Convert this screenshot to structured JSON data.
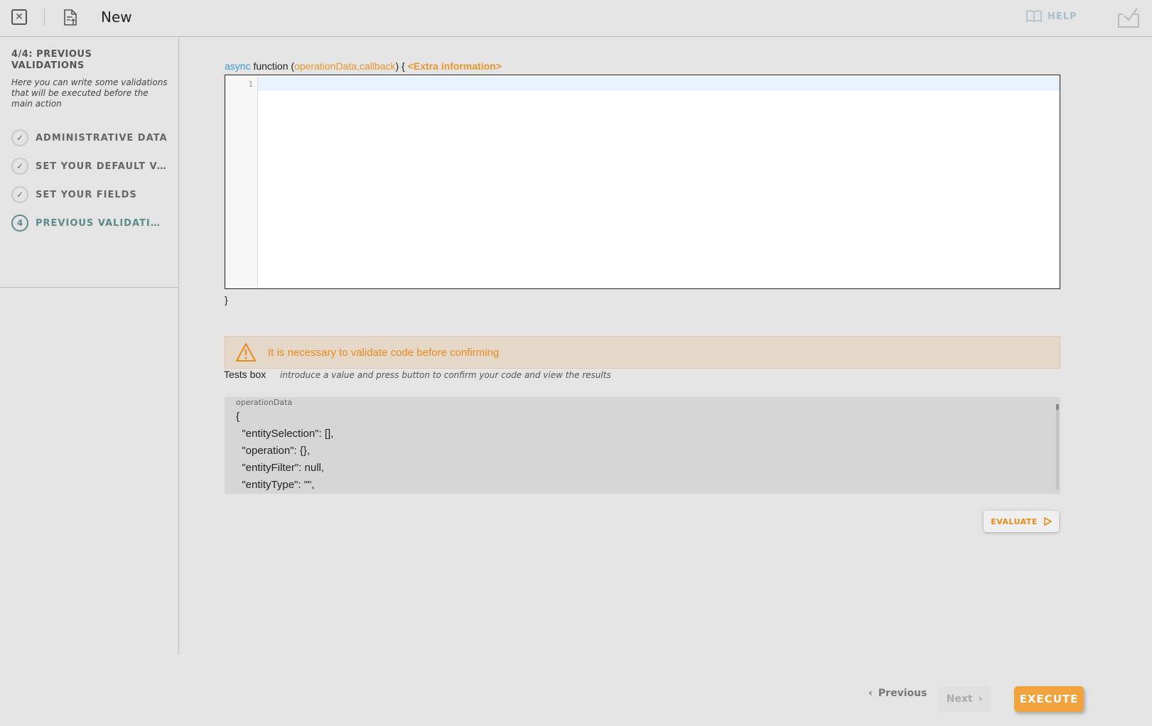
{
  "header": {
    "title": "New",
    "help_label": "HELP"
  },
  "sidebar": {
    "step_title": "4/4: PREVIOUS VALIDATIONS",
    "step_description": "Here you can write some validations that will be executed before the main action",
    "steps": [
      {
        "label": "ADMINISTRATIVE DATA",
        "status": "done"
      },
      {
        "label": "SET YOUR DEFAULT VALUES",
        "status": "done"
      },
      {
        "label": "SET YOUR FIELDS",
        "status": "done"
      },
      {
        "label": "PREVIOUS VALIDATIONS",
        "status": "active",
        "number": "4"
      }
    ]
  },
  "editor": {
    "signature_keyword": "async",
    "signature_function": "function (",
    "signature_params": "operationData,callback",
    "signature_close": ") {",
    "signature_extra": "<Extra information>",
    "line_number": "1",
    "closing_brace": "}"
  },
  "warning": {
    "text": "It is necessary to validate code before confirming"
  },
  "tests": {
    "label": "Tests box",
    "hint": "introduce a value and press button to confirm your code and view the results",
    "caption": "operationData",
    "content": "{\n  \"entitySelection\": [],\n  \"operation\": {},\n  \"entityFilter\": null,\n  \"entityType\": \"\","
  },
  "buttons": {
    "evaluate": "EVALUATE",
    "previous": "Previous",
    "next": "Next",
    "execute": "EXECUTE"
  },
  "colors": {
    "accent": "#e98a1b",
    "active_step": "#5e8a8c",
    "keyword": "#3d9ad4",
    "warning_bg": "#e6d8c9"
  }
}
